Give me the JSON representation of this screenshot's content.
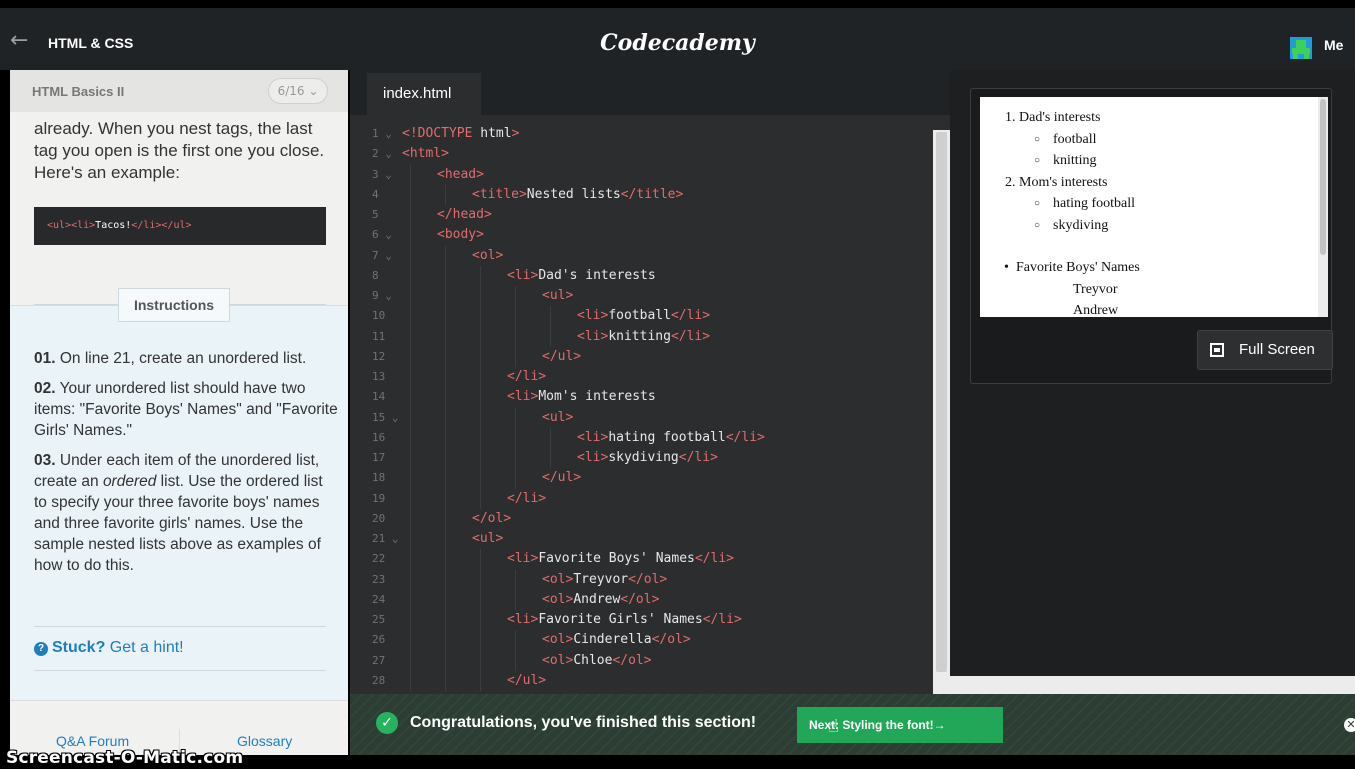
{
  "topbar": {
    "back_icon": "arrow-left-icon",
    "course_title": "HTML & CSS",
    "logo": "Codecademy",
    "user_label": "Me"
  },
  "lesson": {
    "header_title": "HTML Basics II",
    "progress": "6/16 ⌄",
    "paragraph": "already. When you nest tags, the last tag you open is the first one you close. Here's an example:",
    "code_example": {
      "open": "<ul><li>",
      "text": "Tacos!",
      "close": "</li></ul>"
    },
    "instructions_tab": "Instructions",
    "steps": [
      {
        "num": "01.",
        "text": " On line 21, create an unordered list."
      },
      {
        "num": "02.",
        "text": " Your unordered list should have two items: \"Favorite Boys' Names\" and \"Favorite Girls' Names.\""
      },
      {
        "num": "03.",
        "pre": " Under each item of the unordered list, create an ",
        "em": "ordered",
        "post": " list. Use the ordered list to specify your three favorite boys' names and three favorite girls' names. Use the sample nested lists above as examples of how to do this."
      }
    ],
    "hint": {
      "strong": "Stuck?",
      "text": " Get a hint!"
    },
    "footer": {
      "forum": "Q&A Forum",
      "glossary": "Glossary"
    }
  },
  "editor": {
    "tab_label": "index.html",
    "lines": [
      {
        "n": "1 ⌄",
        "indent": 0,
        "parts": [
          [
            "t",
            "<!DOCTYPE"
          ],
          [
            "w",
            " html"
          ],
          [
            "t",
            ">"
          ]
        ]
      },
      {
        "n": "2 ⌄",
        "indent": 0,
        "parts": [
          [
            "t",
            "<html>"
          ]
        ]
      },
      {
        "n": "3 ⌄",
        "indent": 1,
        "parts": [
          [
            "t",
            "<head>"
          ]
        ]
      },
      {
        "n": "4",
        "indent": 2,
        "parts": [
          [
            "t",
            "<title>"
          ],
          [
            "w",
            "Nested lists"
          ],
          [
            "t",
            "</title>"
          ]
        ]
      },
      {
        "n": "5",
        "indent": 1,
        "parts": [
          [
            "t",
            "</head>"
          ]
        ]
      },
      {
        "n": "6 ⌄",
        "indent": 1,
        "parts": [
          [
            "t",
            "<body>"
          ]
        ]
      },
      {
        "n": "7 ⌄",
        "indent": 2,
        "parts": [
          [
            "t",
            "<ol>"
          ]
        ]
      },
      {
        "n": "8",
        "indent": 3,
        "parts": [
          [
            "t",
            "<li>"
          ],
          [
            "w",
            "Dad's interests"
          ]
        ]
      },
      {
        "n": "9 ⌄",
        "indent": 4,
        "parts": [
          [
            "t",
            "<ul>"
          ]
        ]
      },
      {
        "n": "10",
        "indent": 5,
        "parts": [
          [
            "t",
            "<li>"
          ],
          [
            "w",
            "football"
          ],
          [
            "t",
            "</li>"
          ]
        ]
      },
      {
        "n": "11",
        "indent": 5,
        "parts": [
          [
            "t",
            "<li>"
          ],
          [
            "w",
            "knitting"
          ],
          [
            "t",
            "</li>"
          ]
        ]
      },
      {
        "n": "12",
        "indent": 4,
        "parts": [
          [
            "t",
            "</ul>"
          ]
        ]
      },
      {
        "n": "13",
        "indent": 3,
        "parts": [
          [
            "t",
            "</li>"
          ]
        ]
      },
      {
        "n": "14",
        "indent": 3,
        "parts": [
          [
            "t",
            "<li>"
          ],
          [
            "w",
            "Mom's interests"
          ]
        ]
      },
      {
        "n": "15 ⌄",
        "indent": 4,
        "parts": [
          [
            "t",
            "<ul>"
          ]
        ]
      },
      {
        "n": "16",
        "indent": 5,
        "parts": [
          [
            "t",
            "<li>"
          ],
          [
            "w",
            "hating football"
          ],
          [
            "t",
            "</li>"
          ]
        ]
      },
      {
        "n": "17",
        "indent": 5,
        "parts": [
          [
            "t",
            "<li>"
          ],
          [
            "w",
            "skydiving"
          ],
          [
            "t",
            "</li>"
          ]
        ]
      },
      {
        "n": "18",
        "indent": 4,
        "parts": [
          [
            "t",
            "</ul>"
          ]
        ]
      },
      {
        "n": "19",
        "indent": 3,
        "parts": [
          [
            "t",
            "</li>"
          ]
        ]
      },
      {
        "n": "20",
        "indent": 2,
        "parts": [
          [
            "t",
            "</ol>"
          ]
        ]
      },
      {
        "n": "21 ⌄",
        "indent": 2,
        "parts": [
          [
            "t",
            "<ul>"
          ]
        ]
      },
      {
        "n": "22",
        "indent": 3,
        "parts": [
          [
            "t",
            "<li>"
          ],
          [
            "w",
            "Favorite Boys' Names"
          ],
          [
            "t",
            "</li>"
          ]
        ]
      },
      {
        "n": "23",
        "indent": 4,
        "parts": [
          [
            "t",
            "<ol>"
          ],
          [
            "w",
            "Treyvor"
          ],
          [
            "t",
            "</ol>"
          ]
        ]
      },
      {
        "n": "24",
        "indent": 4,
        "parts": [
          [
            "t",
            "<ol>"
          ],
          [
            "w",
            "Andrew"
          ],
          [
            "t",
            "</ol>"
          ]
        ]
      },
      {
        "n": "25",
        "indent": 3,
        "parts": [
          [
            "t",
            "<li>"
          ],
          [
            "w",
            "Favorite Girls' Names"
          ],
          [
            "t",
            "</li>"
          ]
        ]
      },
      {
        "n": "26",
        "indent": 4,
        "parts": [
          [
            "t",
            "<ol>"
          ],
          [
            "w",
            "Cinderella"
          ],
          [
            "t",
            "</ol>"
          ]
        ]
      },
      {
        "n": "27",
        "indent": 4,
        "parts": [
          [
            "t",
            "<ol>"
          ],
          [
            "w",
            "Chloe"
          ],
          [
            "t",
            "</ol>"
          ]
        ]
      },
      {
        "n": "28",
        "indent": 3,
        "parts": [
          [
            "t",
            "</ul>"
          ]
        ]
      }
    ]
  },
  "preview": {
    "ordered": [
      {
        "label": "1.",
        "text": "Dad's interests",
        "subs": [
          "football",
          "knitting"
        ]
      },
      {
        "label": "2.",
        "text": "Mom's interests",
        "subs": [
          "hating football",
          "skydiving"
        ]
      }
    ],
    "unordered_item": "Favorite Boys' Names",
    "names": [
      "Treyvor",
      "Andrew"
    ],
    "fullscreen_label": "Full Screen"
  },
  "success": {
    "message": "Congratulations, you've finished this section!",
    "next_label": "Next: Styling the font!→"
  },
  "watermark": "Screencast-O-Matic.com"
}
